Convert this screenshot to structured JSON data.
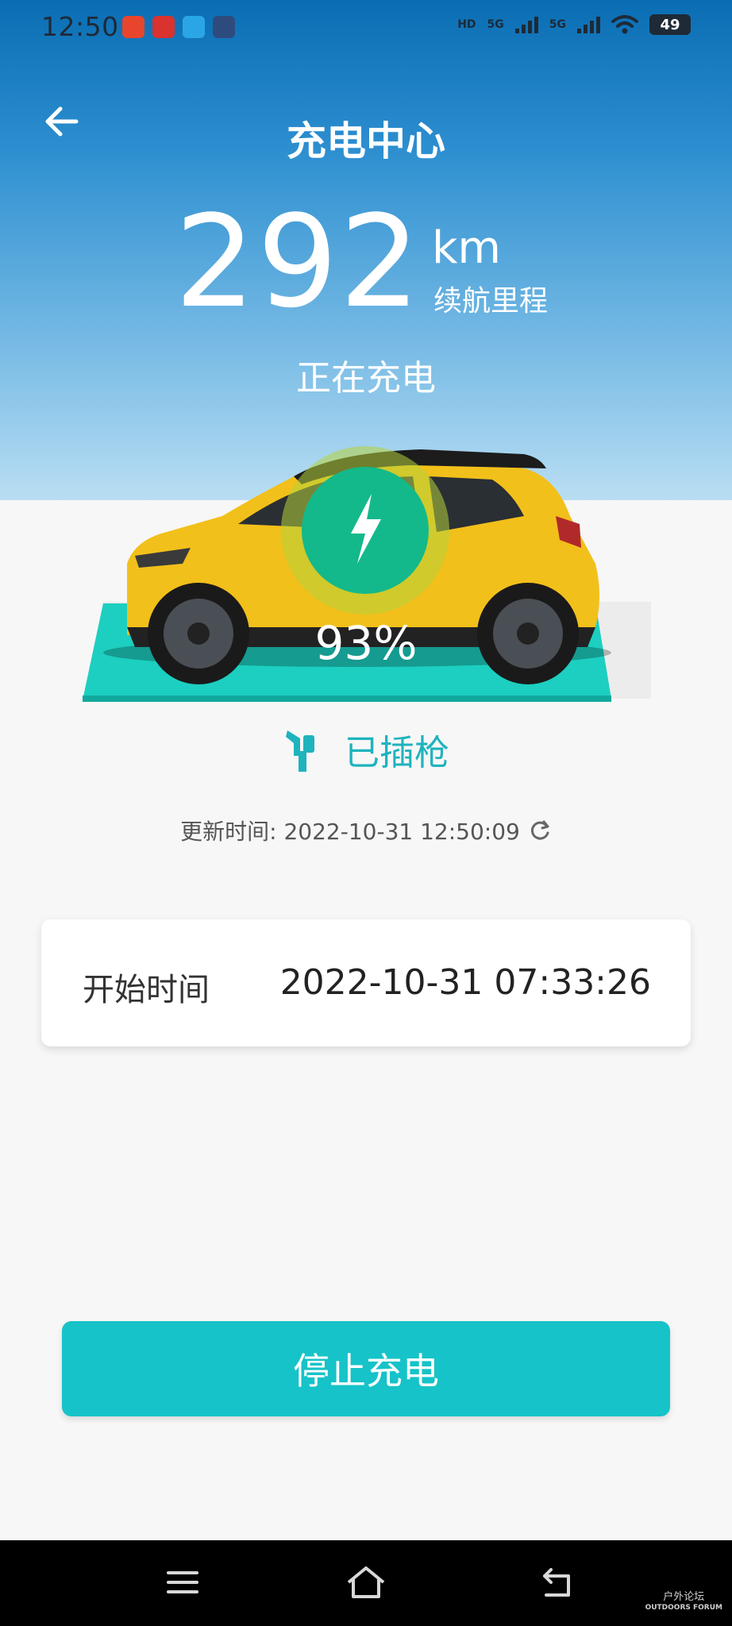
{
  "status_bar": {
    "time": "12:50",
    "network_1": "5G",
    "network_2": "5G",
    "hd_label": "HD",
    "battery": "49"
  },
  "header": {
    "title": "充电中心"
  },
  "range": {
    "value": "292",
    "unit": "km",
    "label": "续航里程"
  },
  "charging": {
    "status": "正在充电",
    "percent": "93%",
    "percent_value": 93,
    "plug_status": "已插枪"
  },
  "update": {
    "text": "更新时间: 2022-10-31 12:50:09"
  },
  "start_card": {
    "label": "开始时间",
    "value": "2022-10-31 07:33:26"
  },
  "actions": {
    "stop_label": "停止充电"
  },
  "colors": {
    "accent": "#16c3c8",
    "header_top": "#0a6db3",
    "car_body": "#f2c01a",
    "platform": "#1ccfc0"
  },
  "icons": {
    "back": "arrow-left-icon",
    "bolt": "lightning-icon",
    "plug": "charging-plug-icon",
    "refresh": "refresh-icon",
    "nav_menu": "menu-icon",
    "nav_home": "home-icon",
    "nav_back": "back-icon"
  },
  "watermark": {
    "line1": "户外论坛",
    "line2": "OUTDOORS FORUM"
  }
}
